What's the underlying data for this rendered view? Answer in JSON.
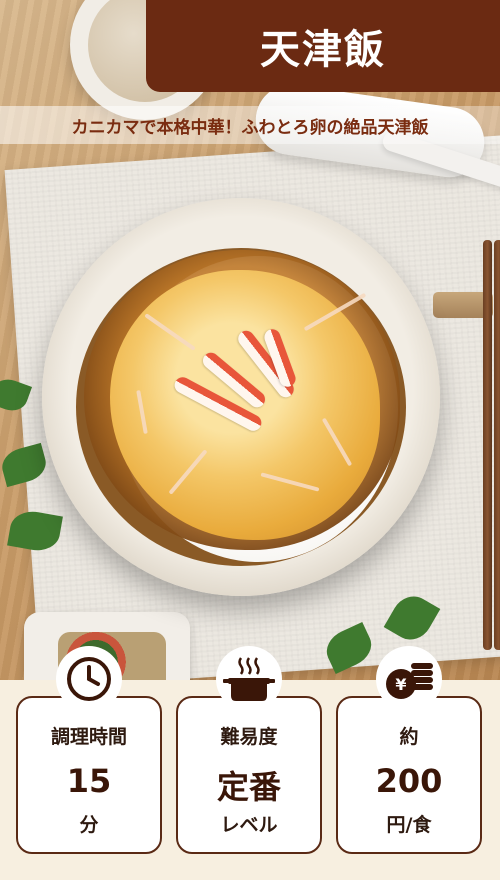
{
  "header": {
    "title": "天津飯",
    "subtitle": "カニカマで本格中華！ふわとろ卵の絶品天津飯"
  },
  "info_cards": [
    {
      "icon": "clock-icon",
      "label": "調理時間",
      "value": "15",
      "unit": "分"
    },
    {
      "icon": "cooking-pot-icon",
      "label": "難易度",
      "value": "定番",
      "unit": "レベル"
    },
    {
      "icon": "coins-yen-icon",
      "label": "約",
      "value": "200",
      "unit": "円/食"
    }
  ],
  "colors": {
    "banner_bg": "#6b2a12",
    "subtitle_text": "#7a2c10",
    "card_border": "#5a2a15",
    "page_bg": "#f7efe0"
  }
}
